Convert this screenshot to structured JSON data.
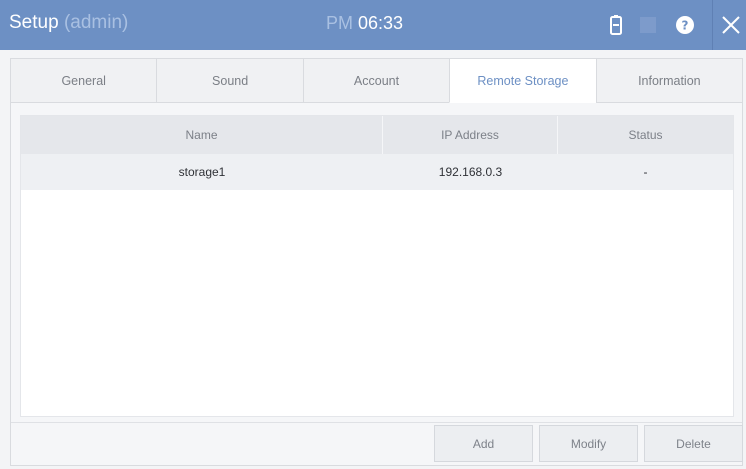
{
  "window": {
    "title": "Setup",
    "title_user": "(admin)",
    "clock_ampm": "PM",
    "clock_time": "06:33",
    "icons": [
      "battery-icon",
      "help-icon",
      "close-icon"
    ]
  },
  "tabs": [
    {
      "label": "General",
      "active": false
    },
    {
      "label": "Sound",
      "active": false
    },
    {
      "label": "Account",
      "active": false
    },
    {
      "label": "Remote Storage",
      "active": true
    },
    {
      "label": "Information",
      "active": false
    }
  ],
  "table": {
    "columns": [
      "Name",
      "IP Address",
      "Status"
    ],
    "rows": [
      {
        "name": "storage1",
        "ip": "192.168.0.3",
        "status": "-"
      }
    ]
  },
  "buttons": {
    "add": "Add",
    "modify": "Modify",
    "delete": "Delete"
  },
  "colors": {
    "titlebar": "#6d90c4",
    "accent": "#6d90c4"
  }
}
